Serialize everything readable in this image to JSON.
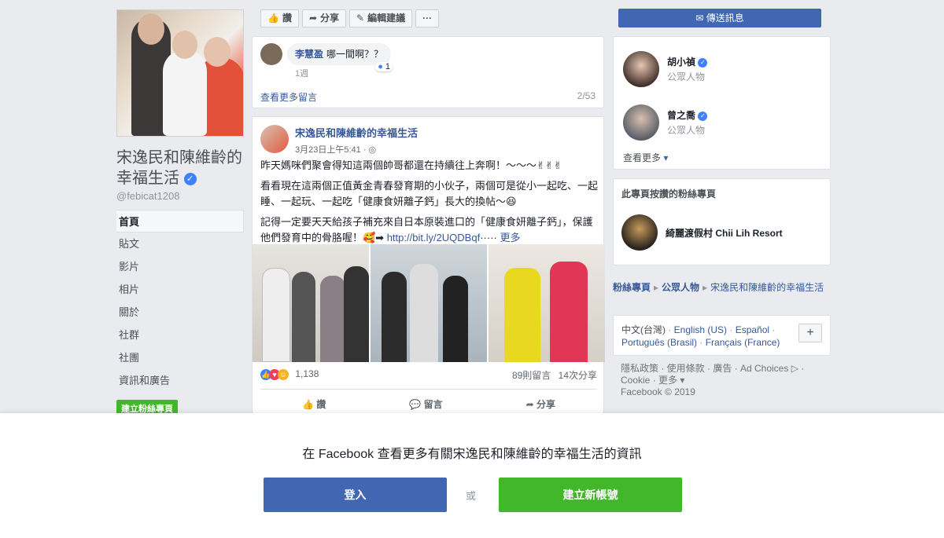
{
  "page": {
    "name_line1": "宋逸民和陳維齡的",
    "name_line2": "幸福生活",
    "handle": "@febicat1208"
  },
  "nav": {
    "items": [
      {
        "label": "首頁"
      },
      {
        "label": "貼文"
      },
      {
        "label": "影片"
      },
      {
        "label": "相片"
      },
      {
        "label": "關於"
      },
      {
        "label": "社群"
      },
      {
        "label": "社團"
      },
      {
        "label": "資訊和廣告"
      }
    ],
    "create_page": "建立粉絲專頁"
  },
  "actionbar": {
    "like": "讚",
    "share": "分享",
    "suggest_edits": "編輯建議",
    "more": "···",
    "send_message": "傳送訊息"
  },
  "comment": {
    "author": "李慧盈",
    "text": "哪一間啊？？",
    "reactions": "1",
    "time": "1週",
    "view_more": "查看更多留言",
    "count": "2/53"
  },
  "post": {
    "author": "宋逸民和陳維齡的幸福生活",
    "time": "3月23日上午5:41 · ◎",
    "para1": "昨天媽咪們聚會得知這兩個帥哥都還在持續往上奔啊！～～～✌✌✌",
    "para2": "看看現在這兩個正值黃金青春發育期的小伙子，兩個可是從小一起吃、一起睡、一起玩、一起吃「健康食妍離子鈣」長大的換帖～😆",
    "para3": "記得一定要天天給孩子補充來自日本原裝進口的「健康食妍離子鈣」，保護他們發育中的骨胳喔！🥰➡ ",
    "link": "http://bit.ly/2UQDBqf",
    "ellipsis": "·····",
    "more": "更多",
    "reaction_count": "1,138",
    "comments": "89則留言",
    "shares": "14次分享",
    "btn_like": "讚",
    "btn_comment": "留言",
    "btn_share": "分享"
  },
  "people": [
    {
      "name": "胡小禎",
      "sub": "公眾人物"
    },
    {
      "name": "曾之喬",
      "sub": "公眾人物"
    }
  ],
  "see_more": "查看更多",
  "liked_pages": {
    "title": "此專頁按讚的粉絲專頁",
    "item": "綺麗渡假村 Chii Lih Resort"
  },
  "breadcrumb": {
    "a": "粉絲專頁",
    "b": "公眾人物",
    "c": "宋逸民和陳維齡的幸福生活"
  },
  "languages": {
    "current": "中文(台灣)",
    "l1": "English (US)",
    "l2": "Español",
    "l3": "Português (Brasil)",
    "l4": "Français (France)",
    "plus": "+"
  },
  "footer": {
    "line1": "隱私政策 · 使用條款 · 廣告 · Ad Choices ▷ ·",
    "line2": "Cookie · 更多 ▾",
    "line3": "Facebook © 2019"
  },
  "overlay": {
    "text": "在 Facebook 查看更多有關宋逸民和陳維齡的幸福生活的資訊",
    "login": "登入",
    "or": "或",
    "signup": "建立新帳號"
  },
  "colors": {
    "fb_blue": "#4267b2",
    "green": "#42b72a",
    "link": "#385898"
  }
}
